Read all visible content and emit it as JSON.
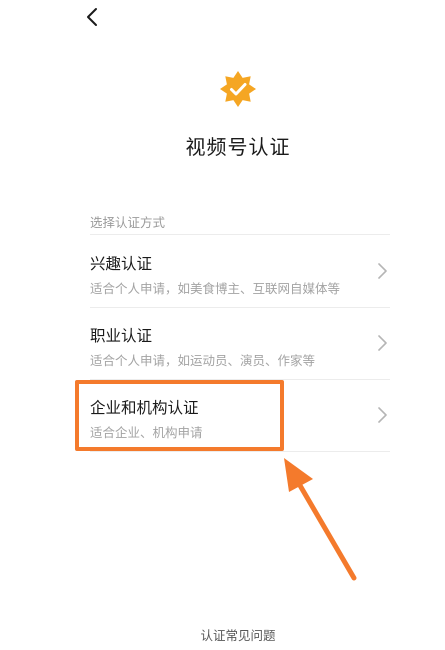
{
  "header": {
    "back_icon": "chevron-left-icon"
  },
  "badge": {
    "icon": "verified-badge-icon",
    "color": "#f5a623"
  },
  "title": "视频号认证",
  "section_label": "选择认证方式",
  "options": [
    {
      "title": "兴趣认证",
      "desc": "适合个人申请，如美食博主、互联网自媒体等",
      "icon": "chevron-right-icon"
    },
    {
      "title": "职业认证",
      "desc": "适合个人申请，如运动员、演员、作家等",
      "icon": "chevron-right-icon"
    },
    {
      "title": "企业和机构认证",
      "desc": "适合企业、机构申请",
      "icon": "chevron-right-icon"
    }
  ],
  "annotation": {
    "color": "#f47a2c",
    "highlighted_option": "企业和机构认证"
  },
  "footer": {
    "faq_label": "认证常见问题"
  }
}
